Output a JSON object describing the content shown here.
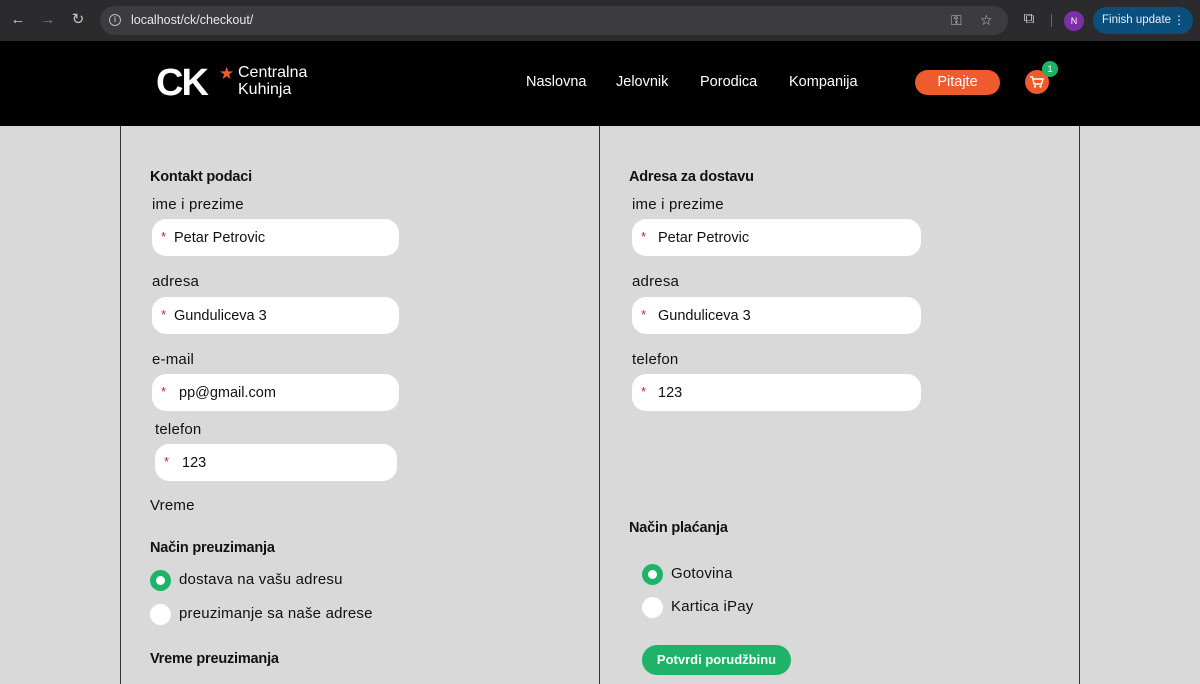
{
  "browser": {
    "url": "localhost/ck/checkout/",
    "profile_initial": "N",
    "finish_update_label": "Finish update"
  },
  "header": {
    "logo_ck": "CK",
    "logo_line1": "Centralna",
    "logo_line2": "Kuhinja",
    "nav": [
      "Naslovna",
      "Jelovnik",
      "Porodica",
      "Kompanija"
    ],
    "ask_button": "Pitajte",
    "cart_count": "1"
  },
  "contact": {
    "title": "Kontakt podaci",
    "name_label": "ime i prezime",
    "name_value": "Petar Petrovic",
    "address_label": "adresa",
    "address_value": "Gunduliceva 3",
    "email_label": "e-mail",
    "email_value": "pp@gmail.com",
    "phone_label": "telefon",
    "phone_value": "123",
    "time_label": "Vreme",
    "required_mark": "*"
  },
  "pickup": {
    "title": "Način preuzimanja",
    "options": [
      "dostava na vašu adresu",
      "preuzimanje sa naše adrese"
    ],
    "selected_index": 0,
    "time_title": "Vreme preuzimanja"
  },
  "delivery": {
    "title": "Adresa za dostavu",
    "name_label": "ime i prezime",
    "name_value": "Petar Petrovic",
    "address_label": "adresa",
    "address_value": "Gunduliceva 3",
    "phone_label": "telefon",
    "phone_value": "123"
  },
  "payment": {
    "title": "Način plaćanja",
    "options": [
      "Gotovina",
      "Kartica iPay"
    ],
    "selected_index": 0,
    "submit_label": "Potvrdi porudžbinu"
  },
  "colors": {
    "accent_orange": "#ef5b2d",
    "accent_green": "#1fb369",
    "page_background": "#d9d9d9"
  }
}
